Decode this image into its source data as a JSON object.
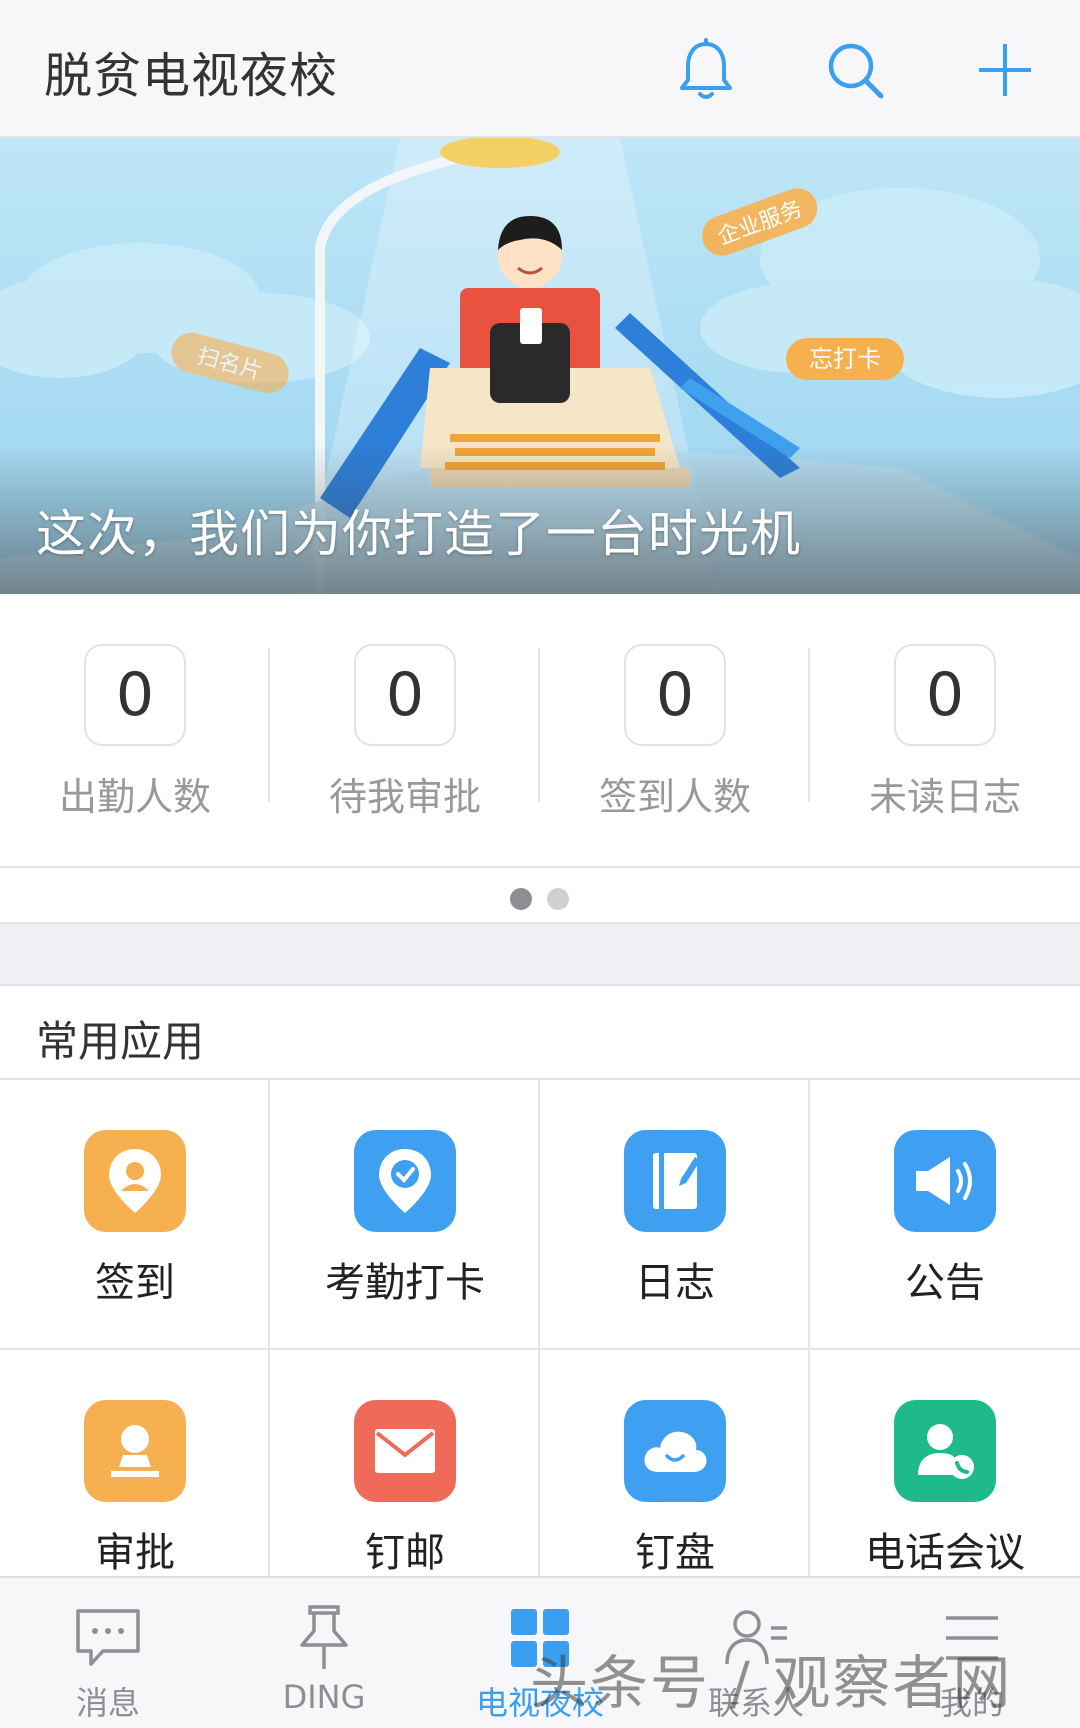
{
  "header": {
    "title": "脱贫电视夜校"
  },
  "banner": {
    "caption": "这次，我们为你打造了一台时光机",
    "tags": [
      "企业服务",
      "忘打卡",
      "扫名片"
    ]
  },
  "stats": [
    {
      "value": "0",
      "label": "出勤人数"
    },
    {
      "value": "0",
      "label": "待我审批"
    },
    {
      "value": "0",
      "label": "签到人数"
    },
    {
      "value": "0",
      "label": "未读日志"
    }
  ],
  "apps": {
    "title": "常用应用",
    "items": [
      {
        "label": "签到",
        "icon": "location-person-icon",
        "color": "#f7b04f"
      },
      {
        "label": "考勤打卡",
        "icon": "location-check-icon",
        "color": "#3f9ff1"
      },
      {
        "label": "日志",
        "icon": "notebook-icon",
        "color": "#3f9ff1"
      },
      {
        "label": "公告",
        "icon": "megaphone-icon",
        "color": "#3f9ff1"
      },
      {
        "label": "审批",
        "icon": "approval-stamp-icon",
        "color": "#f7b04f"
      },
      {
        "label": "钉邮",
        "icon": "mail-icon",
        "color": "#f06a5a"
      },
      {
        "label": "钉盘",
        "icon": "cloud-icon",
        "color": "#3f9ff1"
      },
      {
        "label": "电话会议",
        "icon": "phone-contact-icon",
        "color": "#1fba8a"
      }
    ]
  },
  "tabs": [
    {
      "label": "消息",
      "icon": "chat-icon"
    },
    {
      "label": "DING",
      "icon": "pin-icon"
    },
    {
      "label": "电视夜校",
      "icon": "grid-icon",
      "active": true
    },
    {
      "label": "联系人",
      "icon": "contacts-icon"
    },
    {
      "label": "我的",
      "icon": "menu-icon"
    }
  ],
  "watermark": "头条号 / 观察者网"
}
